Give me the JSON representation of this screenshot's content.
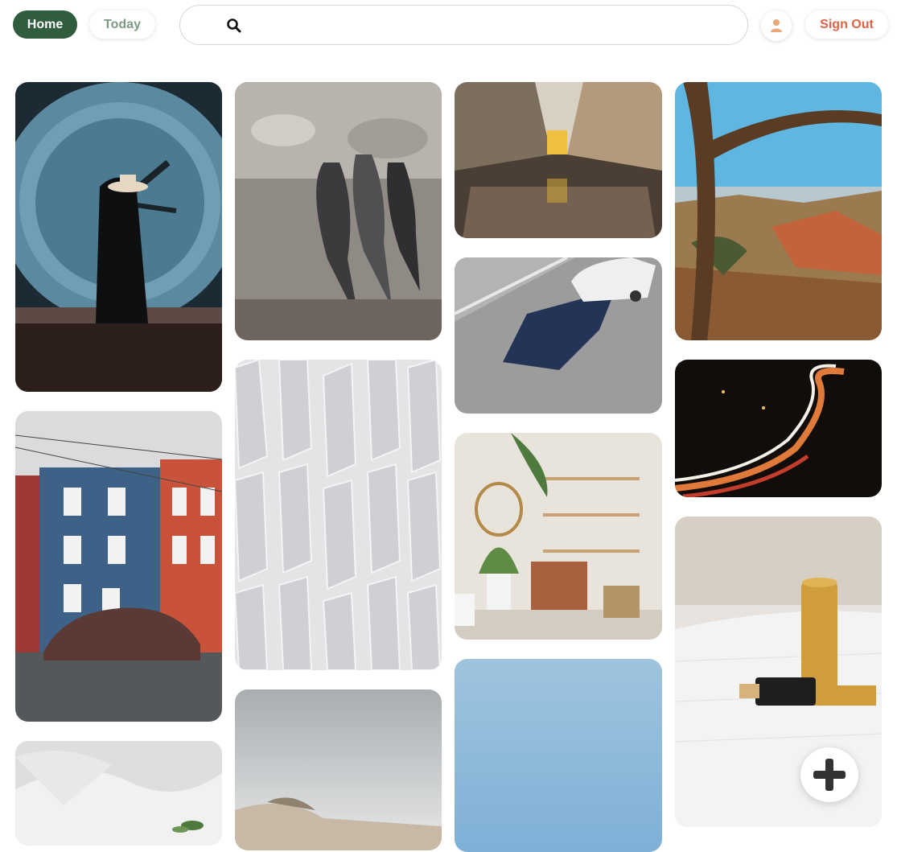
{
  "header": {
    "home_label": "Home",
    "today_label": "Today",
    "search_placeholder": "",
    "sign_out_label": "Sign Out"
  },
  "colors": {
    "home_bg": "#2f5d3e",
    "today_text": "#7d9a85",
    "sign_out_text": "#e06446",
    "avatar_icon": "#e8a97a"
  },
  "pins": [
    {
      "name": "pin-clock-man",
      "subject": "man in hat before giant clock"
    },
    {
      "name": "pin-cormorants",
      "subject": "cormorant birds"
    },
    {
      "name": "pin-street-tram",
      "subject": "street with tram and reflection"
    },
    {
      "name": "pin-desert-canyon",
      "subject": "desert canyon with tree"
    },
    {
      "name": "pin-car-shadow",
      "subject": "white car with long shadow"
    },
    {
      "name": "pin-highway-night",
      "subject": "night highway light trails"
    },
    {
      "name": "pin-colorful-houses",
      "subject": "colorful row houses with covered car"
    },
    {
      "name": "pin-white-facade",
      "subject": "white building facade"
    },
    {
      "name": "pin-shelf-interior",
      "subject": "interior with shelves and plants"
    },
    {
      "name": "pin-toothbrush",
      "subject": "bamboo toothbrush and towel"
    },
    {
      "name": "pin-white-fabric",
      "subject": "white fabric with plant sprout"
    },
    {
      "name": "pin-foggy-beach",
      "subject": "foggy beach"
    },
    {
      "name": "pin-blue-sky",
      "subject": "blue sky"
    }
  ],
  "fab": {
    "icon": "plus-icon"
  }
}
